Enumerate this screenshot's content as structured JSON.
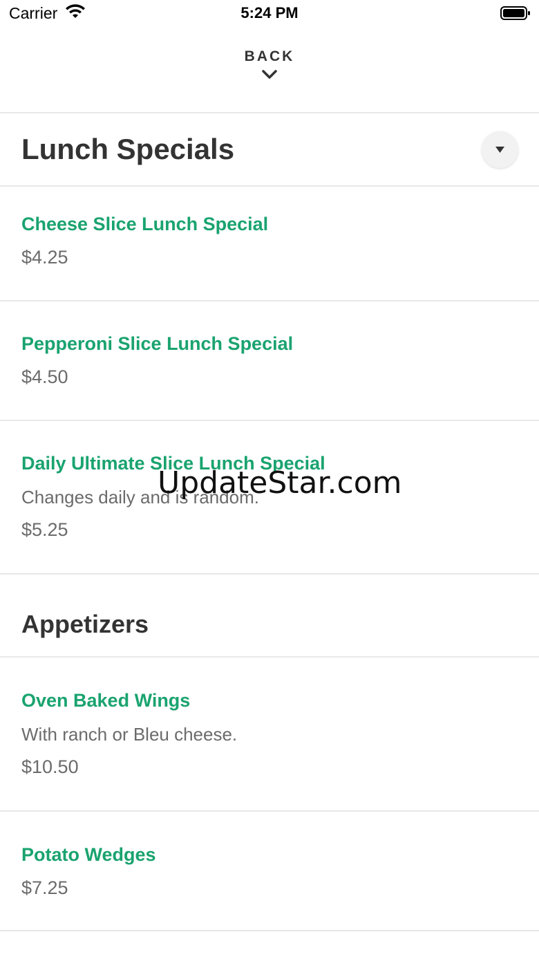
{
  "status_bar": {
    "carrier": "Carrier",
    "time": "5:24 PM",
    "icons": [
      "wifi-icon",
      "battery-icon"
    ]
  },
  "nav": {
    "back_label": "BACK",
    "back_icon": "chevron-down-icon"
  },
  "sections": [
    {
      "title": "Lunch Specials",
      "dropdown_icon": "triangle-down-icon",
      "items": [
        {
          "name": "Cheese Slice Lunch Special",
          "price": "$4.25"
        },
        {
          "name": "Pepperoni Slice Lunch Special",
          "price": "$4.50"
        },
        {
          "name": "Daily Ultimate Slice Lunch Special",
          "description": "Changes daily and is random.",
          "price": "$5.25"
        }
      ]
    },
    {
      "title": "Appetizers",
      "items": [
        {
          "name": "Oven Baked Wings",
          "description": "With ranch or Bleu cheese.",
          "price": "$10.50"
        },
        {
          "name": "Potato Wedges",
          "price": "$7.25"
        }
      ]
    }
  ],
  "watermark": "UpdateStar.com",
  "colors": {
    "item_name": "#1aa36f",
    "text_secondary": "#6b6b6b",
    "divider": "#e8e8e8"
  }
}
